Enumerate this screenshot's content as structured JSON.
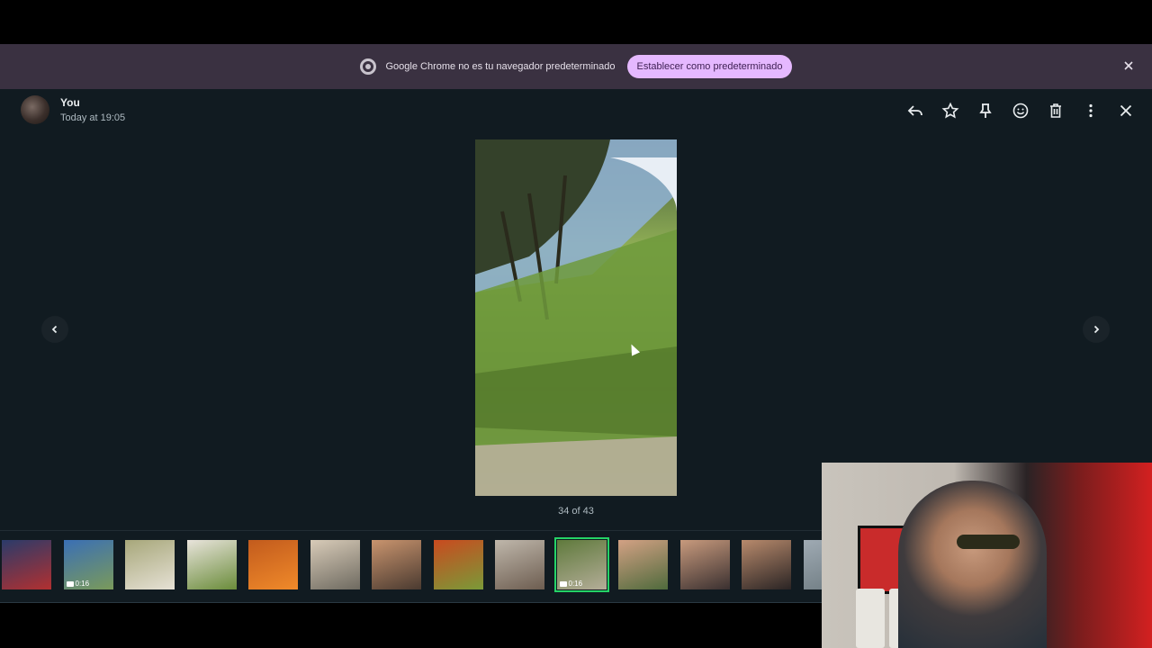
{
  "infobar": {
    "message": "Google Chrome no es tu navegador predeterminado",
    "button_label": "Establecer como predeterminado",
    "icon": "chrome-icon"
  },
  "viewer": {
    "sender": "You",
    "timestamp": "Today at 19:05",
    "actions": [
      "reply-icon",
      "star-icon",
      "pin-icon",
      "emoji-icon",
      "delete-icon",
      "more-icon",
      "close-icon"
    ],
    "counter": "34 of 43",
    "thumbnails": [
      {
        "colors": [
          "#2a3b6a",
          "#b23030"
        ],
        "duration": ""
      },
      {
        "colors": [
          "#3a6fb5",
          "#7a9a5a"
        ],
        "duration": "0:16"
      },
      {
        "colors": [
          "#a7a77a",
          "#e6e1d5"
        ],
        "duration": ""
      },
      {
        "colors": [
          "#e9e4dc",
          "#6a8c3a"
        ],
        "duration": ""
      },
      {
        "colors": [
          "#c25b1d",
          "#f08a2a"
        ],
        "duration": ""
      },
      {
        "colors": [
          "#d8cbb8",
          "#6e6a60"
        ],
        "duration": ""
      },
      {
        "colors": [
          "#c9946e",
          "#4a3a30"
        ],
        "duration": ""
      },
      {
        "colors": [
          "#c94a1f",
          "#7a9a38"
        ],
        "duration": ""
      },
      {
        "colors": [
          "#bfb7ab",
          "#6d5d50"
        ],
        "duration": ""
      },
      {
        "colors": [
          "#5f7a3c",
          "#b4ad98"
        ],
        "duration": "0:16",
        "active": true
      },
      {
        "colors": [
          "#d3a184",
          "#4f6a3c"
        ],
        "duration": ""
      },
      {
        "colors": [
          "#c89a7d",
          "#3a3030"
        ],
        "duration": ""
      },
      {
        "colors": [
          "#b88a6c",
          "#2a2424"
        ],
        "duration": ""
      },
      {
        "colors": [
          "#9faab3",
          "#6d7a80"
        ],
        "duration": ""
      }
    ]
  },
  "colors": {
    "infobar_bg": "#3a3141",
    "button_bg": "#e5b8ff",
    "viewer_bg": "#111b21",
    "active_outline": "#25d366"
  }
}
